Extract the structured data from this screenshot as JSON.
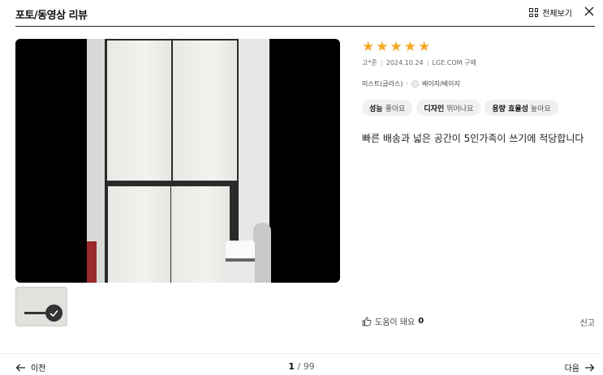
{
  "header": {
    "title": "포토/동영상 리뷰",
    "view_all_label": "전체보기",
    "view_all_icon": "grid-icon",
    "close_icon": "close-icon"
  },
  "review": {
    "rating": 5,
    "rating_max": 5,
    "stars": [
      "★",
      "★",
      "★",
      "★",
      "★"
    ],
    "star_color": "#f5a623",
    "author": "고*준",
    "date": "2024.10.24",
    "source": "LGE.COM 구매",
    "option_main": "미스트(글라스)",
    "option_separator": "·",
    "option_color": "베이지/베이지",
    "tags": [
      {
        "key": "성능",
        "value": "좋아요"
      },
      {
        "key": "디자인",
        "value": "뛰어나요"
      },
      {
        "key": "용량 효율성",
        "value": "높아요"
      }
    ],
    "text": "빠른 배송과 넓은 공간이 5인가족이 쓰기에 적당합니다"
  },
  "actions": {
    "helpful_label": "도움이 돼요",
    "helpful_count": "0",
    "report_label": "신고"
  },
  "footer": {
    "prev_label": "이전",
    "next_label": "다음",
    "current_page": "1",
    "page_separator": "/",
    "total_pages": "99"
  }
}
